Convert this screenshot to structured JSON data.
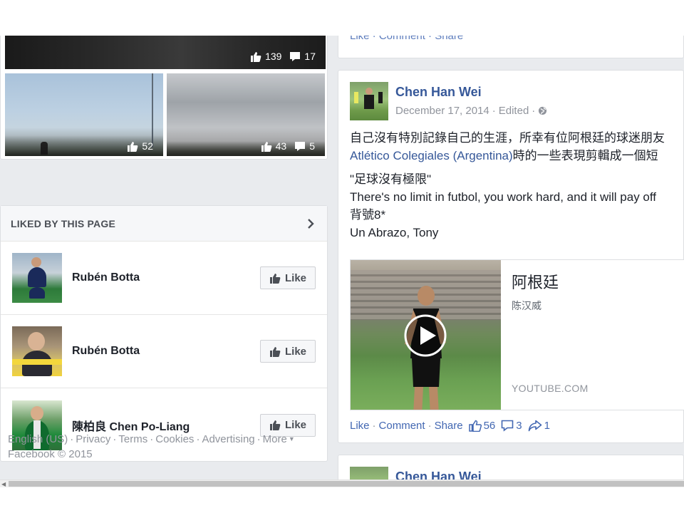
{
  "photos": {
    "top": {
      "likes": "139",
      "comments": "17"
    },
    "left": {
      "likes": "52"
    },
    "right": {
      "likes": "43",
      "comments": "5"
    }
  },
  "liked_by": {
    "title": "LIKED BY THIS PAGE",
    "items": [
      {
        "name": "Rubén Botta",
        "button": "Like"
      },
      {
        "name": "Rubén Botta",
        "button": "Like"
      },
      {
        "name": "陳柏良 Chen Po-Liang",
        "button": "Like"
      }
    ]
  },
  "footer": {
    "links": [
      "English (US)",
      "Privacy",
      "Terms",
      "Cookies",
      "Advertising",
      "More"
    ],
    "copyright": "Facebook © 2015"
  },
  "prev_post": {
    "actions": "Like · Comment · Share"
  },
  "post": {
    "author": "Chen Han Wei",
    "date": "December 17, 2014",
    "edited": "Edited",
    "text_line1": "自己沒有特別記錄自己的生涯，所幸有位阿根廷的球迷朋友",
    "text_line2_link": "Atlético Colegiales (Argentina)",
    "text_line2_rest": "時的一些表現剪輯成一個短",
    "quote": "\"足球沒有極限\"",
    "english": "There's no limit in futbol, you work hard, and it will pay off",
    "jersey": "背號8*",
    "signoff": "Un Abrazo, Tony",
    "video": {
      "title": "阿根廷",
      "subtitle": "陈汉威",
      "domain": "YOUTUBE.COM"
    },
    "actions": {
      "like": "Like",
      "comment": "Comment",
      "share": "Share"
    },
    "stats": {
      "likes": "56",
      "comments": "3",
      "shares": "1"
    }
  },
  "next_post": {
    "author": "Chen Han Wei"
  },
  "colors": {
    "link": "#365899",
    "action": "#4267b2",
    "muted": "#90949c",
    "bg": "#e9ebee"
  }
}
